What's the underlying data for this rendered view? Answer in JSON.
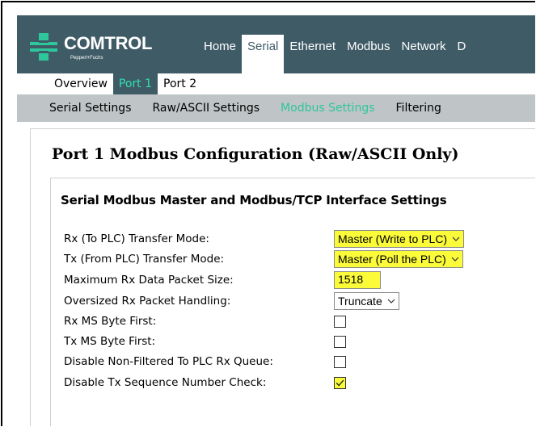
{
  "brand": {
    "name": "COMTROL",
    "tagline": "Pepperl+Fuchs"
  },
  "nav": {
    "items": [
      {
        "label": "Home",
        "active": false
      },
      {
        "label": "Serial",
        "active": true
      },
      {
        "label": "Ethernet",
        "active": false
      },
      {
        "label": "Modbus",
        "active": false
      },
      {
        "label": "Network",
        "active": false
      },
      {
        "label": "D",
        "active": false
      }
    ]
  },
  "ports": {
    "items": [
      {
        "label": "Overview",
        "active": false
      },
      {
        "label": "Port 1",
        "active": true
      },
      {
        "label": "Port 2",
        "active": false
      }
    ]
  },
  "subnav": {
    "items": [
      {
        "label": "Serial Settings",
        "active": false
      },
      {
        "label": "Raw/ASCII Settings",
        "active": false
      },
      {
        "label": "Modbus Settings",
        "active": true
      },
      {
        "label": "Filtering",
        "active": false
      }
    ]
  },
  "page": {
    "title": "Port 1 Modbus Configuration (Raw/ASCII Only)"
  },
  "section": {
    "title": "Serial Modbus Master and Modbus/TCP Interface Settings",
    "fields": [
      {
        "label": "Rx (To PLC) Transfer Mode:",
        "type": "select",
        "value": "Master (Write to PLC)",
        "highlight": true
      },
      {
        "label": "Tx (From PLC) Transfer Mode:",
        "type": "select",
        "value": "Master (Poll the PLC)",
        "highlight": true
      },
      {
        "label": "Maximum Rx Data Packet Size:",
        "type": "text",
        "value": "1518",
        "highlight": true
      },
      {
        "label": "Oversized Rx Packet Handling:",
        "type": "select",
        "value": "Truncate",
        "highlight": false
      },
      {
        "label": "Rx MS Byte First:",
        "type": "checkbox",
        "checked": false
      },
      {
        "label": "Tx MS Byte First:",
        "type": "checkbox",
        "checked": false
      },
      {
        "label": "Disable Non-Filtered To PLC Rx Queue:",
        "type": "checkbox",
        "checked": false
      },
      {
        "label": "Disable Tx Sequence Number Check:",
        "type": "checkbox",
        "checked": true
      }
    ]
  },
  "colors": {
    "header": "#3f5b66",
    "accent": "#2ec79c",
    "highlight": "#fbfb3a",
    "subnav": "#bfc4c6"
  }
}
